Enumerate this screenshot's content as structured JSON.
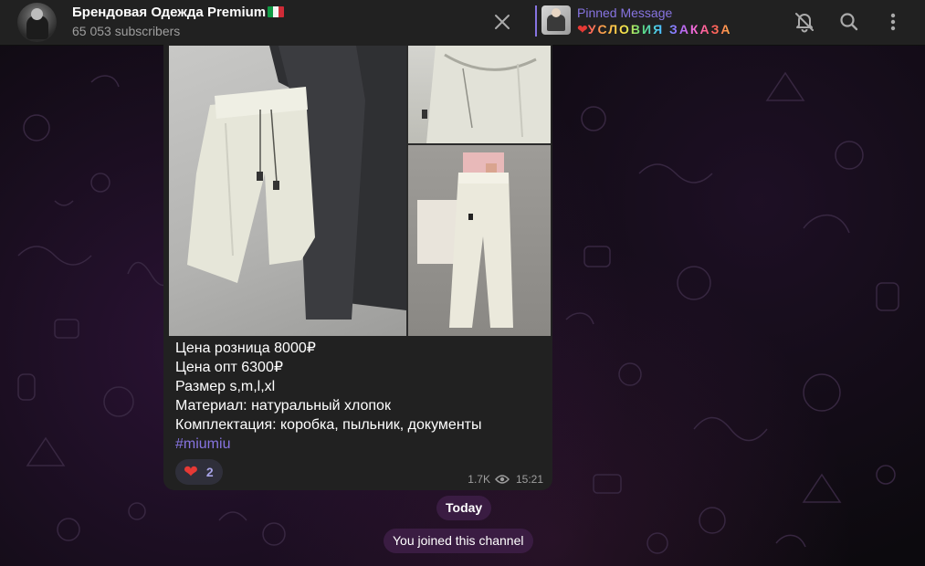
{
  "header": {
    "channel_title": "Брендовая Одежда Premium",
    "subscribers": "65 053 subscribers",
    "pinned_label": "Pinned Message",
    "pinned_heart": "❤",
    "pinned_text": "УСЛОВИЯ ЗАКАЗА"
  },
  "icons": {
    "close": "close-icon",
    "mute": "bell-off-icon",
    "search": "search-icon",
    "menu": "more-vertical-icon"
  },
  "message": {
    "lines": [
      "Цена розница 8000₽",
      "Цена опт 6300₽",
      "Размер s,m,l,xl",
      "Материал: натуральный хлопок",
      "Комплектация: коробка, пыльник, документы"
    ],
    "hashtag": "#miumiu",
    "reaction_emoji": "❤",
    "reaction_count": "2",
    "views": "1.7K",
    "time": "15:21"
  },
  "service": {
    "date_label": "Today",
    "joined_label": "You joined this channel"
  },
  "colors": {
    "accent": "#8774e1",
    "header_bg": "#212121",
    "bubble_bg": "#212121",
    "heart": "#e53935"
  }
}
